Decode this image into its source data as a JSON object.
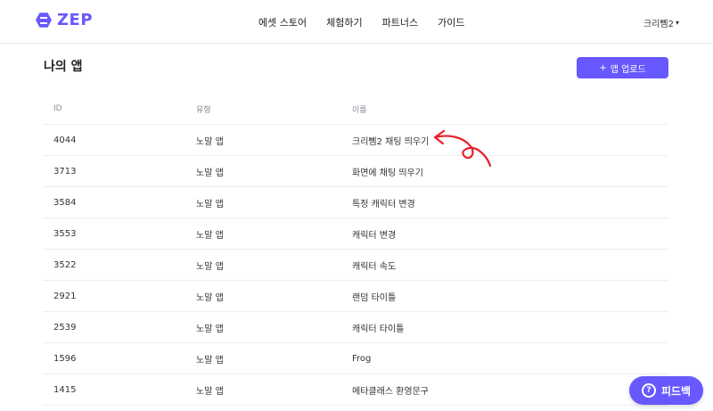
{
  "header": {
    "logo_text": "ZEP",
    "nav": [
      "에셋 스토어",
      "체험하기",
      "파트너스",
      "가이드"
    ],
    "user_name": "크리뻼2",
    "caret": "▾"
  },
  "main": {
    "title": "나의 앱",
    "upload_button": {
      "icon": "+",
      "label": "앱 업로드"
    },
    "columns": [
      "ID",
      "유형",
      "이름"
    ],
    "rows": [
      {
        "id": "4044",
        "type": "노말 앱",
        "name": "크리뻼2 채팅 띄우기"
      },
      {
        "id": "3713",
        "type": "노말 앱",
        "name": "화면에 채팅 띄우기"
      },
      {
        "id": "3584",
        "type": "노말 앱",
        "name": "특정 캐릭터 변경"
      },
      {
        "id": "3553",
        "type": "노말 앱",
        "name": "캐릭터 변경"
      },
      {
        "id": "3522",
        "type": "노말 앱",
        "name": "캐릭터 속도"
      },
      {
        "id": "2921",
        "type": "노말 앱",
        "name": "랜덤 타이틀"
      },
      {
        "id": "2539",
        "type": "노말 앱",
        "name": "캐릭터 타이틀"
      },
      {
        "id": "1596",
        "type": "노말 앱",
        "name": "Frog"
      },
      {
        "id": "1415",
        "type": "노말 앱",
        "name": "메타클래스 환영문구"
      }
    ]
  },
  "feedback": {
    "icon": "?",
    "label": "피드백"
  },
  "colors": {
    "accent": "#6758ff",
    "annotation": "#e8202a"
  },
  "icons": {
    "logo": "zep-logo-icon",
    "arrow": "annotation-arrow-icon",
    "help": "help-circle-icon"
  }
}
